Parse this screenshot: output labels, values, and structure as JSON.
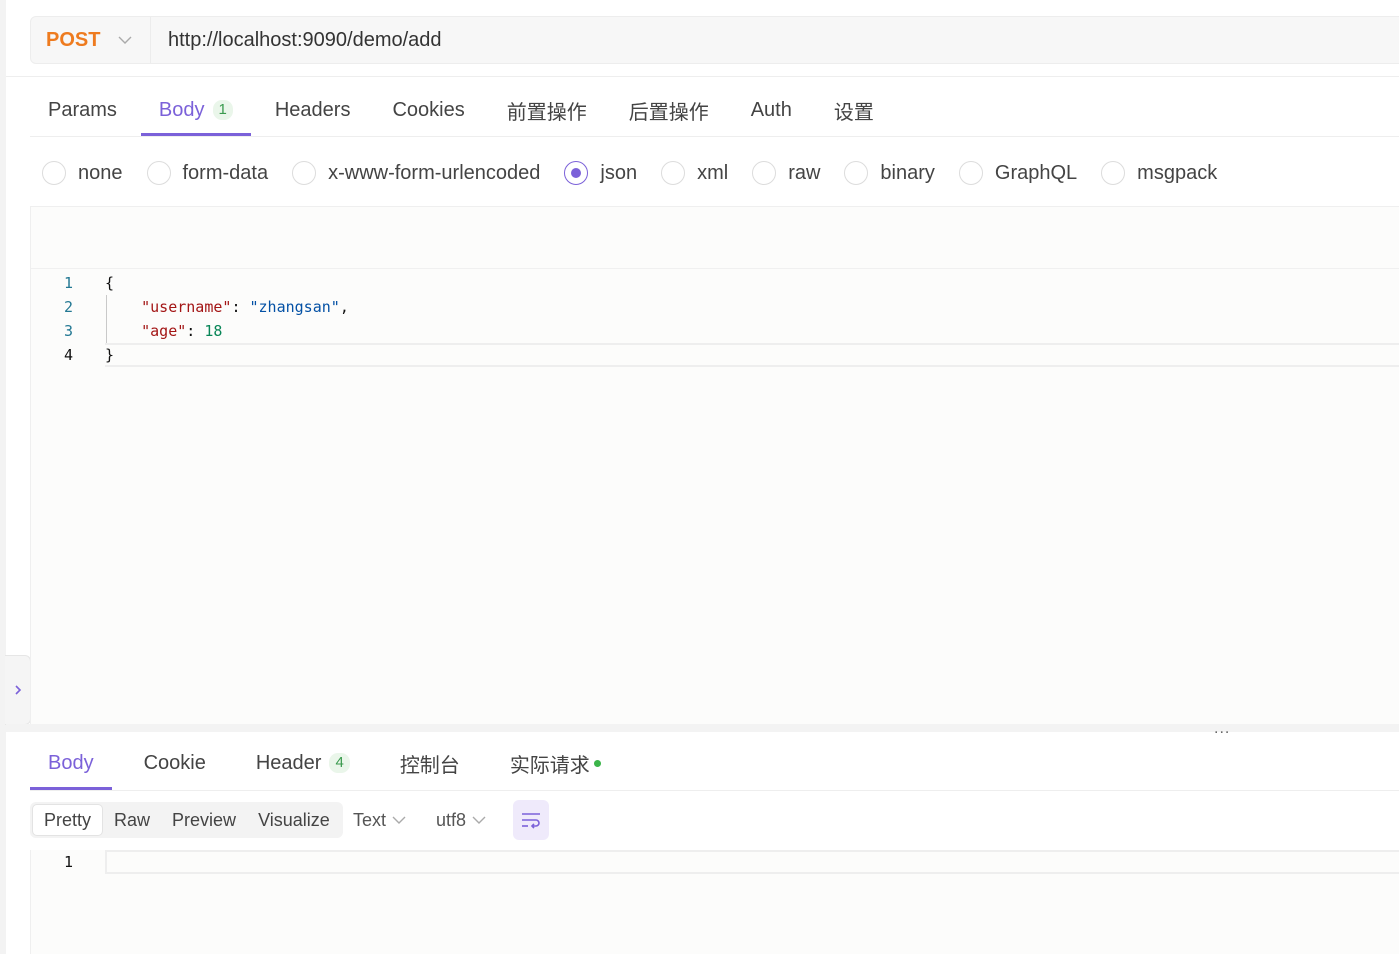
{
  "request": {
    "method": "POST",
    "url": "http://localhost:9090/demo/add",
    "tabs": [
      {
        "label": "Params"
      },
      {
        "label": "Body",
        "badge": "1"
      },
      {
        "label": "Headers"
      },
      {
        "label": "Cookies"
      },
      {
        "label": "前置操作"
      },
      {
        "label": "后置操作"
      },
      {
        "label": "Auth"
      },
      {
        "label": "设置"
      }
    ],
    "active_tab": "Body",
    "body_types": [
      "none",
      "form-data",
      "x-www-form-urlencoded",
      "json",
      "xml",
      "raw",
      "binary",
      "GraphQL",
      "msgpack"
    ],
    "selected_body_type": "json",
    "editor": {
      "line_numbers": [
        "1",
        "2",
        "3",
        "4"
      ],
      "lines": [
        {
          "open": "{"
        },
        {
          "key": "\"username\"",
          "sep": ": ",
          "value": "\"zhangsan\"",
          "end": ","
        },
        {
          "key": "\"age\"",
          "sep": ": ",
          "value": "18",
          "end": ""
        },
        {
          "close": "}"
        }
      ]
    }
  },
  "response": {
    "tabs": [
      {
        "label": "Body"
      },
      {
        "label": "Cookie"
      },
      {
        "label": "Header",
        "badge": "4"
      },
      {
        "label": "控制台"
      },
      {
        "label": "实际请求"
      }
    ],
    "active_tab": "Body",
    "view_modes": [
      "Pretty",
      "Raw",
      "Preview",
      "Visualize"
    ],
    "active_view": "Pretty",
    "format": "Text",
    "encoding": "utf8",
    "editor": {
      "line_numbers": [
        "1"
      ]
    }
  },
  "splitter_dots": "...",
  "colors": {
    "accent": "#7b61d9",
    "method": "#ee7b1f",
    "status_dot": "#3bb54a"
  }
}
